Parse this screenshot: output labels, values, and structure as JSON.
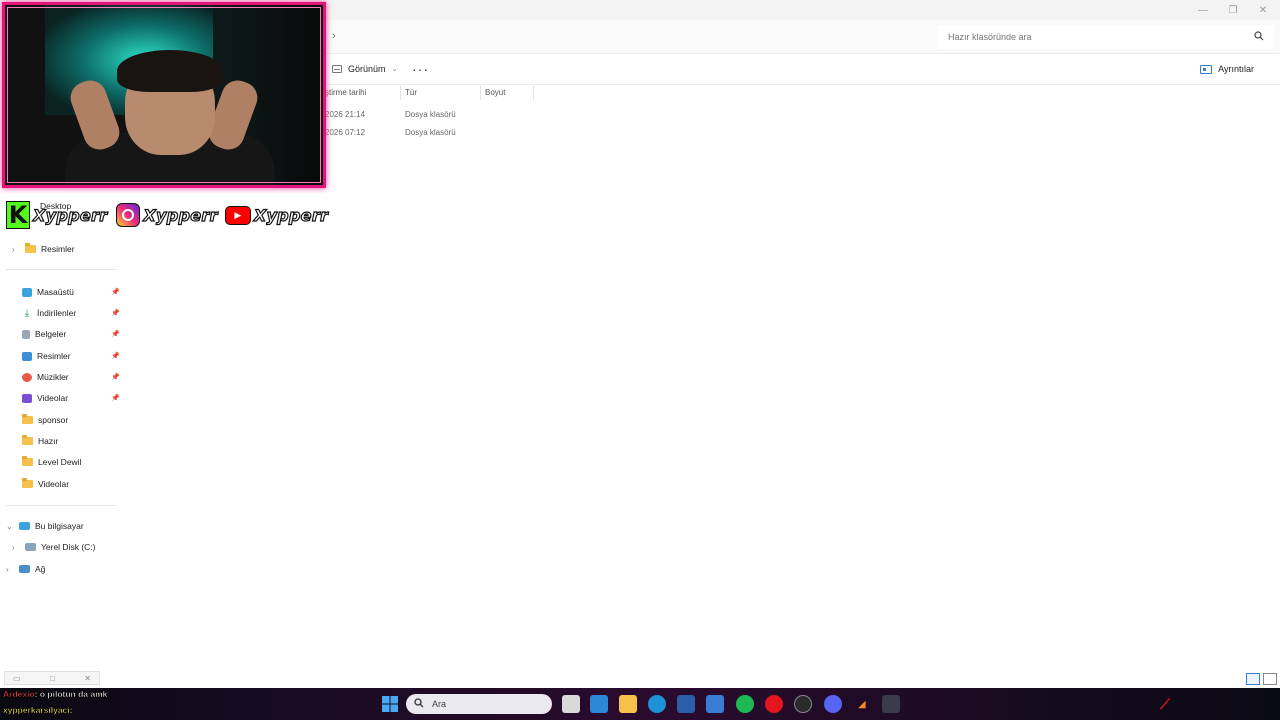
{
  "window": {
    "minimize": "—",
    "maximize": "❐",
    "close": "✕"
  },
  "address": {
    "chevron": "›",
    "search_placeholder": "Hazır klasöründe ara"
  },
  "toolbar": {
    "view_label": "Görünüm",
    "more": "···",
    "details_label": "Ayrıntılar"
  },
  "columns": [
    {
      "label": "ştirme tarihi"
    },
    {
      "label": "Tür"
    },
    {
      "label": "Boyut"
    }
  ],
  "rows": [
    {
      "date": "2026 21:14",
      "type": "Dosya klasörü"
    },
    {
      "date": "2026 07:12",
      "type": "Dosya klasörü"
    }
  ],
  "sidebar": {
    "tree_top": [
      {
        "label": "Desktop"
      },
      {
        "label": "Resimler"
      }
    ],
    "quick_access": [
      {
        "label": "Masaüstü",
        "pinned": true
      },
      {
        "label": "İndirilenler",
        "pinned": true
      },
      {
        "label": "Belgeler",
        "pinned": true
      },
      {
        "label": "Resimler",
        "pinned": true
      },
      {
        "label": "Müzikler",
        "pinned": true
      },
      {
        "label": "Videolar",
        "pinned": true
      },
      {
        "label": "sponsor",
        "pinned": false
      },
      {
        "label": "Hazır",
        "pinned": false
      },
      {
        "label": "Level Dewil",
        "pinned": false
      },
      {
        "label": "Videolar",
        "pinned": false
      }
    ],
    "this_pc": "Bu bilgisayar",
    "local_disk": "Yerel Disk (C:)",
    "network": "Ağ"
  },
  "overlay": {
    "kick_letter": "K",
    "handles": [
      "Xypperr",
      "Xypperr",
      "Xypperr"
    ]
  },
  "chat": [
    {
      "user": "Ardexio",
      "message": ": o pilotun da amk"
    },
    {
      "user": "xypperkarsilyaci",
      "message": ":"
    }
  ],
  "taskbar": {
    "search_label": "Ara"
  },
  "colors": {
    "webcam_border": "#e4157a",
    "kick": "#53fc18",
    "youtube": "#ff0000",
    "folder": "#f5c14b"
  }
}
